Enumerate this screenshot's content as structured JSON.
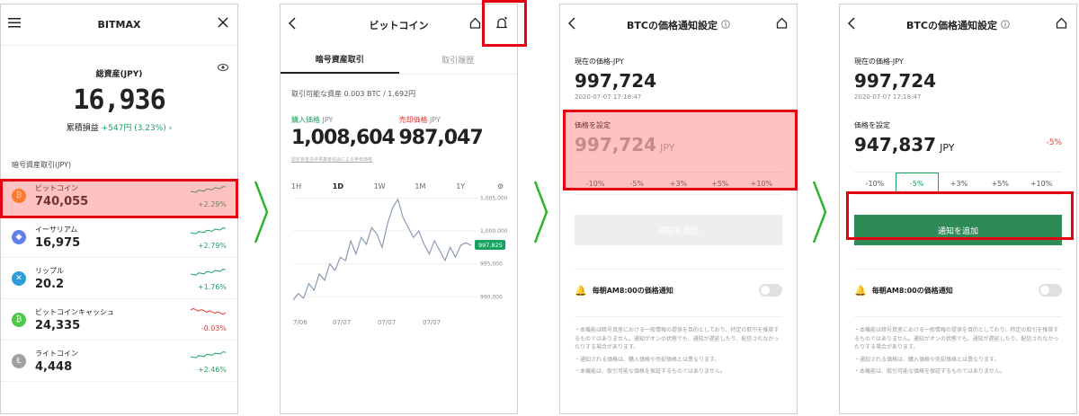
{
  "p1": {
    "title": "BITMAX",
    "total_label": "総資産(JPY)",
    "total_value": "16,936",
    "pl_label": "累積損益",
    "pl_value": "+547円 (3.23%) ›",
    "section": "暗号資産取引(JPY)",
    "coins": [
      {
        "name": "ビットコイン",
        "price": "740,055",
        "change": "+2.29%",
        "color": "#f7931a",
        "glyph": "₿",
        "dir": "up"
      },
      {
        "name": "イーサリアム",
        "price": "16,975",
        "change": "+2.79%",
        "color": "#627eea",
        "glyph": "◆",
        "dir": "up"
      },
      {
        "name": "リップル",
        "price": "20.2",
        "change": "+1.76%",
        "color": "#2a9dd8",
        "glyph": "✕",
        "dir": "up"
      },
      {
        "name": "ビットコインキャッシュ",
        "price": "24,335",
        "change": "-0.03%",
        "color": "#4cc947",
        "glyph": "₿",
        "dir": "down"
      },
      {
        "name": "ライトコイン",
        "price": "4,448",
        "change": "+2.46%",
        "color": "#a0a0a0",
        "glyph": "Ł",
        "dir": "up"
      }
    ]
  },
  "p2": {
    "title": "ビットコイン",
    "tab_active": "暗号資産取引",
    "tab_inactive": "取引履歴",
    "available": "取引可能な資産 0.003 BTC / 1,692円",
    "buy_label": "購入価格",
    "sell_label": "売却価格",
    "currency": "JPY",
    "buy_price": "1,008,604",
    "sell_price": "987,047",
    "note": "認定資金決済事業者協会による参考価格",
    "periods": [
      "1H",
      "1D",
      "1W",
      "1M",
      "1Y"
    ],
    "active_period": "1D",
    "chart_data": {
      "type": "line",
      "y_ticks": [
        "1,005,000",
        "1,000,000",
        "995,000",
        "990,000"
      ],
      "x_ticks": [
        "7/06",
        "07/07",
        "07/07",
        "07/07"
      ],
      "ylim": [
        988000,
        1006000
      ],
      "current_label": "997,825",
      "values": [
        989500,
        990500,
        989800,
        992000,
        991000,
        993500,
        992500,
        995000,
        994000,
        996000,
        995500,
        998500,
        996500,
        999000,
        998000,
        1000500,
        999500,
        997500,
        1001000,
        1003500,
        1004800,
        1002000,
        1000500,
        999000,
        1000000,
        998000,
        996500,
        998500,
        997000,
        995500,
        997500,
        996000,
        997825,
        998200,
        997800
      ]
    }
  },
  "p3": {
    "title": "BTCの価格通知設定",
    "current_label": "現在の価格-JPY",
    "current_price": "997,724",
    "timestamp": "2020-07-07 17:18:47",
    "set_label": "価格を設定",
    "set_price": "997,724",
    "currency": "JPY",
    "pcts": [
      "-10%",
      "-5%",
      "+3%",
      "+5%",
      "+10%"
    ],
    "button": "通知を追加",
    "daily": "毎朝AM8:00の価格通知",
    "disclaimers": [
      "・本機能は暗号資産における一般情報の提供を目的としており、特定の取引を推奨するものではありません。通知がオンの状態でも、通知が遅延したり、配信されなかったりする場合があります。",
      "・通知される価格は、購入価格や売却価格とは異なります。",
      "・本機能は、取引可能な価格を保証するものではありません。"
    ]
  },
  "p4": {
    "title": "BTCの価格通知設定",
    "current_label": "現在の価格-JPY",
    "current_price": "997,724",
    "timestamp": "2020-07-07 17:18:47",
    "set_label": "価格を設定",
    "set_price": "947,837",
    "currency": "JPY",
    "diff": "-5%",
    "pcts": [
      "-10%",
      "-5%",
      "+3%",
      "+5%",
      "+10%"
    ],
    "selected_pct": "-5%",
    "button": "通知を追加",
    "daily": "毎朝AM8:00の価格通知",
    "disclaimers": [
      "・本機能は暗号資産における一般情報の提供を目的としており、特定の取引を推奨するものではありません。通知がオンの状態でも、通知が遅延したり、配信されなかったりする場合があります。",
      "・通知される価格は、購入価格や売却価格とは異なります。",
      "・本機能は、取引可能な価格を保証するものではありません。"
    ]
  },
  "colors": {
    "accent_green": "#1aa260",
    "button_green": "#2e8b57",
    "highlight_red": "#e50012",
    "arrow_green": "#2db52d"
  }
}
